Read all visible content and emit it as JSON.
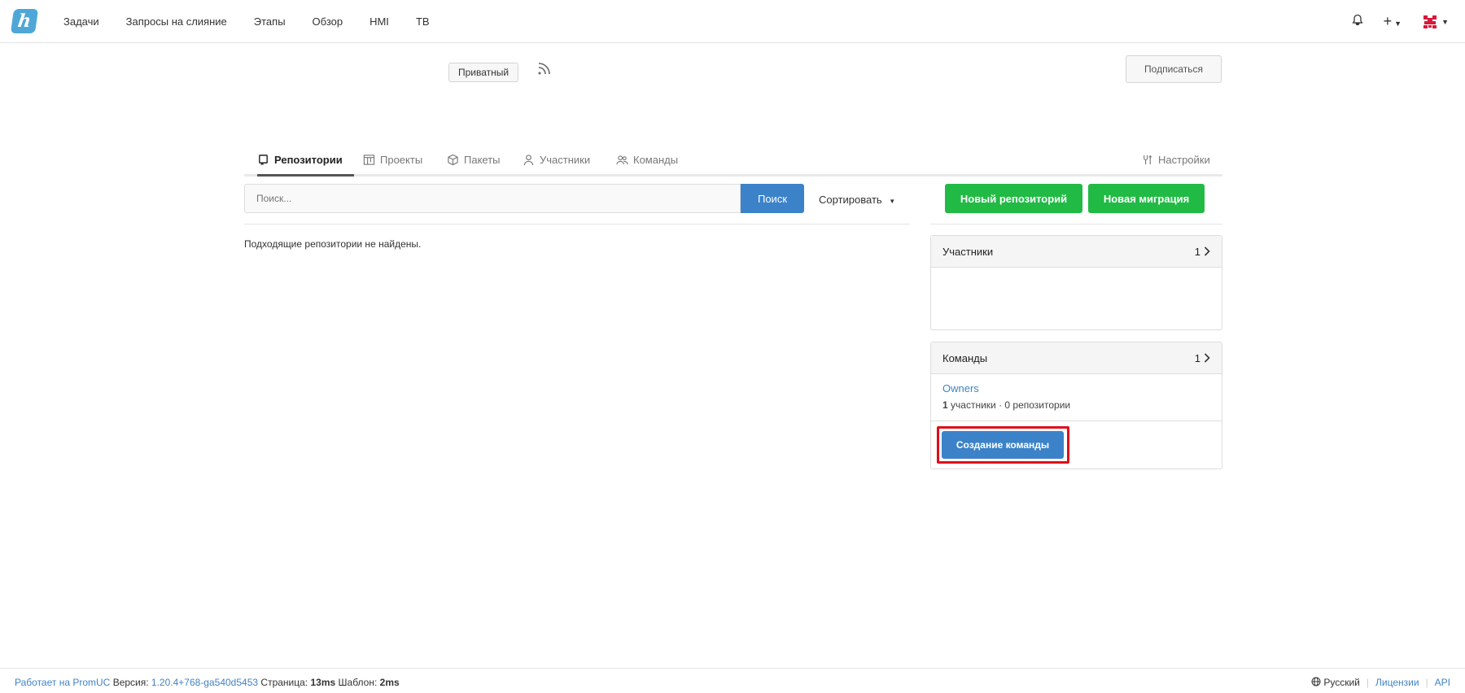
{
  "nav": {
    "logo_letter": "h",
    "items": [
      "Задачи",
      "Запросы на слияние",
      "Этапы",
      "Обзор",
      "HMI",
      "TB"
    ]
  },
  "header": {
    "private_badge": "Приватный",
    "subscribe_label": "Подписаться"
  },
  "tabs": {
    "repositories": "Репозитории",
    "projects": "Проекты",
    "packages": "Пакеты",
    "members": "Участники",
    "teams": "Команды",
    "settings": "Настройки"
  },
  "search": {
    "placeholder": "Поиск...",
    "button": "Поиск",
    "sort_label": "Сортировать"
  },
  "empty_message": "Подходящие репозитории не найдены.",
  "actions": {
    "new_repo": "Новый репозиторий",
    "new_migration": "Новая миграция"
  },
  "members_panel": {
    "title": "Участники",
    "count": "1"
  },
  "teams_panel": {
    "title": "Команды",
    "count": "1",
    "team_name": "Owners",
    "team_members_count": "1",
    "team_meta": "участники · 0 репозитории",
    "create_label": "Создание команды"
  },
  "footer": {
    "powered": "Работает на PromUC",
    "version_label": "Версия:",
    "version": "1.20.4+768-ga540d5453",
    "page_label": "Страница:",
    "page_time": "13ms",
    "template_label": "Шаблон:",
    "template_time": "2ms",
    "language": "Русский",
    "licenses": "Лицензии",
    "api": "API"
  },
  "colors": {
    "primary": "#3b82c9",
    "green": "#21ba45",
    "highlight": "#e00d1a",
    "logo": "#4fa7d8"
  }
}
